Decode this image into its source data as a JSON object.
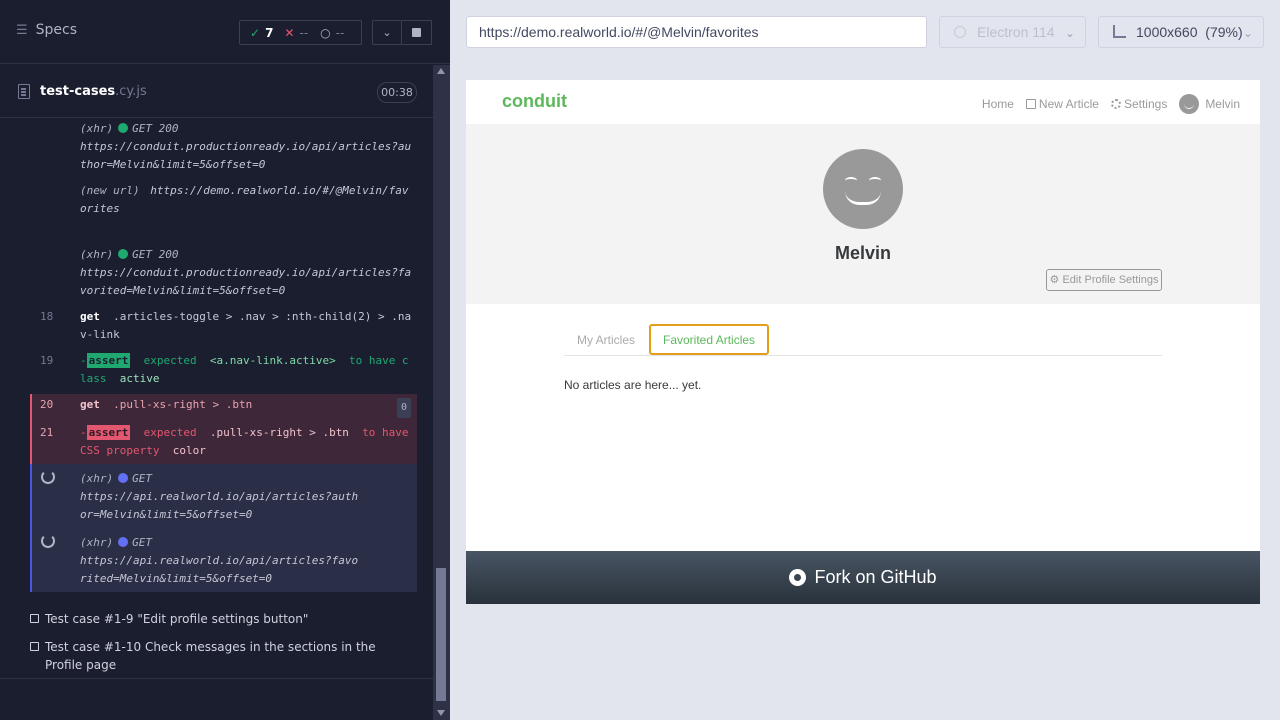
{
  "header": {
    "specs_label": "Specs",
    "passed": "7",
    "failed": "--",
    "pending": "--"
  },
  "file": {
    "name": "test-cases",
    "ext": ".cy.js",
    "duration": "00:38"
  },
  "log": [
    {
      "type": "xhr",
      "prefix": "(xhr)",
      "method": "GET 200",
      "url": "https://conduit.productionready.io/api/articles?author=Melvin&limit=5&offset=0"
    },
    {
      "type": "newurl",
      "prefix": "(new url)",
      "url": "https://demo.realworld.io/#/@Melvin/favorites"
    },
    {
      "type": "xhr",
      "prefix": "(xhr)",
      "method": "GET 200",
      "url": "https://conduit.productionready.io/api/articles?favorited=Melvin&limit=5&offset=0"
    },
    {
      "type": "get",
      "num": "18",
      "cmd": "get",
      "selector": ".articles-toggle > .nav > :nth-child(2) > .nav-link"
    },
    {
      "type": "assert",
      "num": "19",
      "badge": "assert",
      "text1": "expected",
      "target": "<a.nav-link.active>",
      "text2": "to have class",
      "value": "active"
    },
    {
      "type": "get-fail",
      "num": "20",
      "cmd": "get",
      "selector": ".pull-xs-right > .btn",
      "count": "0"
    },
    {
      "type": "assert-fail",
      "num": "21",
      "badge": "assert",
      "text1": "expected",
      "target": ".pull-xs-right > .btn",
      "text2": "to have CSS property",
      "value": "color"
    },
    {
      "type": "pending-xhr",
      "prefix": "(xhr)",
      "method": "GET",
      "url": "https://api.realworld.io/api/articles?author=Melvin&limit=5&offset=0"
    },
    {
      "type": "pending-xhr",
      "prefix": "(xhr)",
      "method": "GET",
      "url": "https://api.realworld.io/api/articles?favorited=Melvin&limit=5&offset=0"
    }
  ],
  "tests": [
    "Test case #1-9 \"Edit profile settings button\"",
    "Test case #1-10 Check messages in the sections in the Profile page"
  ],
  "browser_bar": {
    "url": "https://demo.realworld.io/#/@Melvin/favorites",
    "browser": "Electron 114",
    "viewport": "1000x660  (79%)"
  },
  "app": {
    "brand": "conduit",
    "nav": [
      "Home",
      "New Article",
      "Settings",
      "Melvin"
    ],
    "username": "Melvin",
    "edit_button": "Edit Profile Settings",
    "tabs": [
      "My Articles",
      "Favorited Articles"
    ],
    "empty_message": "No articles are here... yet.",
    "footer": "Fork on GitHub"
  },
  "colors": {
    "pass": "#1fa971",
    "fail": "#e45770",
    "brand": "#5cb85c",
    "focus": "#e59e19"
  }
}
